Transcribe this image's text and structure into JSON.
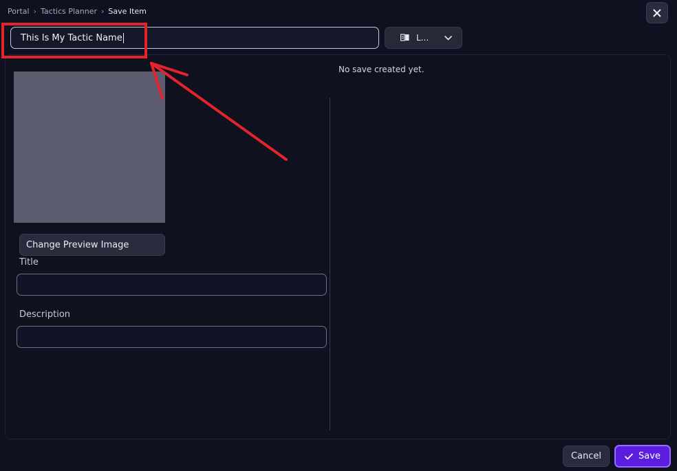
{
  "breadcrumb": {
    "items": [
      "Portal",
      "Tactics Planner",
      "Save Item"
    ]
  },
  "icons": {
    "close": "close-icon",
    "chevron": "chevron-right-icon",
    "language": "book-language-icon",
    "dropdown": "chevron-down-icon",
    "check": "check-icon"
  },
  "name_input": {
    "value": "This Is My Tactic Name"
  },
  "language_select": {
    "value": "L..."
  },
  "preview": {
    "change_button_label": "Change Preview Image"
  },
  "form": {
    "title_label": "Title",
    "title_value": "",
    "description_label": "Description",
    "description_value": ""
  },
  "saves": {
    "empty_text": "No save created yet."
  },
  "footer": {
    "cancel_label": "Cancel",
    "save_label": "Save"
  },
  "colors": {
    "background": "#0f1020",
    "accent": "#5b1ee0",
    "annotation": "#e3242b"
  }
}
